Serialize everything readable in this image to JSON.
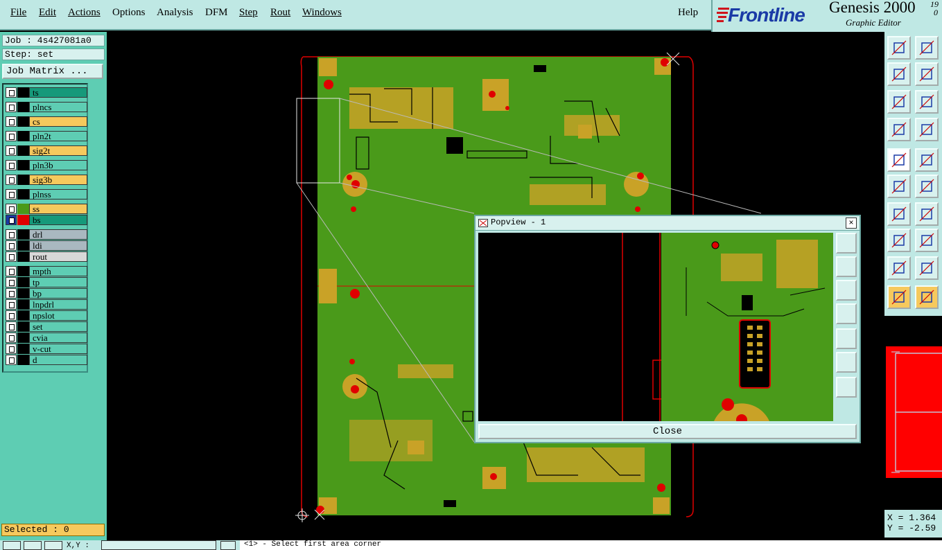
{
  "menu": {
    "file": "File",
    "edit": "Edit",
    "actions": "Actions",
    "options": "Options",
    "analysis": "Analysis",
    "dfm": "DFM",
    "step": "Step",
    "rout": "Rout",
    "windows": "Windows",
    "help": "Help"
  },
  "brand": {
    "logo_text": "Frontline",
    "product": "Genesis 2000",
    "version_top": "19",
    "version_bottom": "0",
    "subtitle": "Graphic Editor"
  },
  "job": {
    "job_line": "Job : 4s427081a0",
    "step_line": "Step: set",
    "matrix_button": "Job Matrix ..."
  },
  "layers": [
    {
      "name": "ts",
      "color": "#16997a"
    },
    {
      "name": "plncs",
      "color": "#5ecdb3"
    },
    {
      "name": "cs",
      "color": "#f6c95d"
    },
    {
      "name": "pln2t",
      "color": "#5ecdb3"
    },
    {
      "name": "sig2t",
      "color": "#f6c95d"
    },
    {
      "name": "pln3b",
      "color": "#5ecdb3"
    },
    {
      "name": "sig3b",
      "color": "#f6c95d"
    },
    {
      "name": "plnss",
      "color": "#5ecdb3"
    },
    {
      "name": "ss",
      "color": "#f6c95d"
    },
    {
      "name": "bs",
      "color": "#16997a"
    },
    {
      "name": "drl",
      "color": "#a9b8c0"
    },
    {
      "name": "ldi",
      "color": "#a9b8c0"
    },
    {
      "name": "rout",
      "color": "#d8d8d8"
    },
    {
      "name": "mpth",
      "color": "#5ecdb3"
    },
    {
      "name": "tp",
      "color": "#5ecdb3"
    },
    {
      "name": "bp",
      "color": "#5ecdb3"
    },
    {
      "name": "lnpdrl",
      "color": "#5ecdb3"
    },
    {
      "name": "npslot",
      "color": "#5ecdb3"
    },
    {
      "name": "set",
      "color": "#5ecdb3"
    },
    {
      "name": "cvia",
      "color": "#5ecdb3"
    },
    {
      "name": "v-cut",
      "color": "#5ecdb3"
    },
    {
      "name": "d",
      "color": "#5ecdb3"
    }
  ],
  "selected": "Selected : 0",
  "popview": {
    "title": "Popview - 1",
    "close_label": "Close",
    "close_x": "×"
  },
  "coords": {
    "x": "X = 1.364",
    "y": "Y = -2.59"
  },
  "status": {
    "xy_label": "X,Y :",
    "prompt": "<1> - Select first area corner"
  },
  "colors": {
    "board_green": "#4a9a1a",
    "pad_gold": "#c9a227",
    "outline_red": "#e00000",
    "panel_teal": "#5ecdb3",
    "menu_bg": "#bfe8e4"
  },
  "toolbar_icons": [
    "zoom-in-icon",
    "zoom-out-icon",
    "pan-left-icon",
    "pan-right-icon",
    "fit-all-icon",
    "fit-profile-icon",
    "measure-icon",
    "snap-icon",
    "select-feature-icon",
    "select-net-icon",
    "connect-icon",
    "delete-icon",
    "line-icon",
    "slash-icon",
    "pad-icon",
    "separator-icon",
    "triangle-icon",
    "arc-icon",
    "pointer-icon",
    "pointer-select-icon"
  ]
}
